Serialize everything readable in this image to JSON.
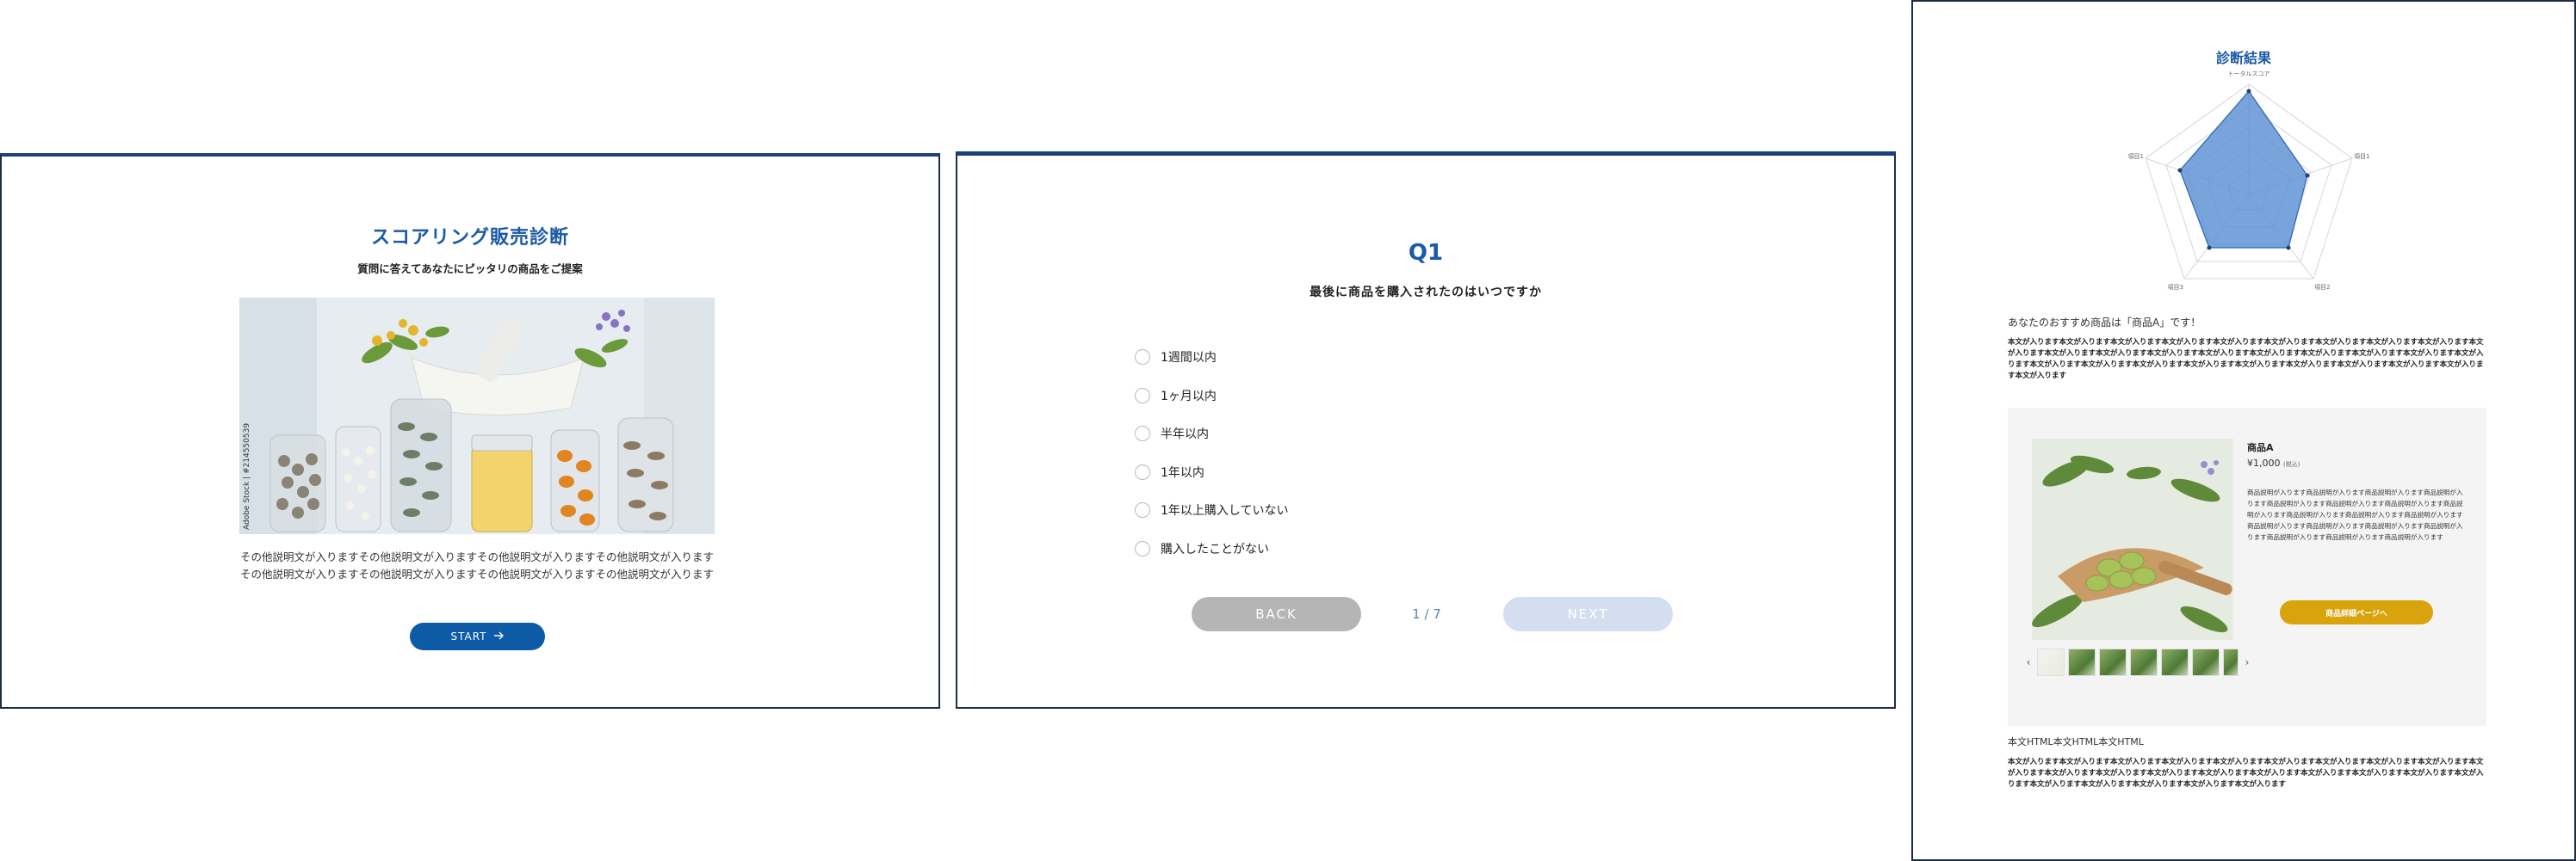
{
  "start": {
    "title": "スコアリング販売診断",
    "subtitle": "質問に答えてあなたにピッタリの商品をご提案",
    "image_credit": "Adobe Stock | #214550539",
    "description": "その他説明文が入りますその他説明文が入りますその他説明文が入りますその他説明文が入りますその他説明文が入りますその他説明文が入りますその他説明文が入りますその他説明文が入ります",
    "start_label": "START",
    "start_icon": "arrow-right-icon",
    "accent_color": "#1a5aa6",
    "button_color": "#0d5aa7"
  },
  "question": {
    "number": "Q1",
    "text": "最後に商品を購入されたのはいつですか",
    "options": [
      "1週間以内",
      "1ヶ月以内",
      "半年以内",
      "1年以内",
      "1年以上購入していない",
      "購入したことがない"
    ],
    "back_label": "BACK",
    "next_label": "NEXT",
    "progress": "1 / 7"
  },
  "result": {
    "title": "診断結果",
    "radar": {
      "axes": [
        "トータルスコア",
        "項目1",
        "項目2",
        "項目3",
        "項目1"
      ],
      "fill_color": "#5a8fd3"
    },
    "recommend_text": "あなたのおすすめ商品は「商品A」です！",
    "body_1": "本文が入ります本文が入ります本文が入ります本文が入ります本文が入ります本文が入ります本文が入ります本文が入ります本文が入ります本文が入ります本文が入ります本文が入ります本文が入ります本文が入ります本文が入ります本文が入ります本文が入ります本文が入ります本文が入ります本文が入ります本文が入ります本文が入ります本文が入ります本文が入ります本文が入ります本文が入ります本文が入ります本文が入ります本文が入ります",
    "product": {
      "name": "商品A",
      "price": "¥1,000",
      "tax": "(税込)",
      "description": "商品説明が入ります商品説明が入ります商品説明が入ります商品説明が入ります商品説明が入ります商品説明が入ります商品説明が入ります商品説明が入ります商品説明が入ります商品説明が入ります商品説明が入ります商品説明が入ります商品説明が入ります商品説明が入ります商品説明が入ります商品説明が入ります商品説明が入ります商品説明が入ります",
      "detail_label": "商品詳細ページへ",
      "detail_color": "#d9a30c",
      "prev_icon": "chevron-left-icon",
      "next_icon": "chevron-right-icon"
    },
    "body_html_label": "本文HTML本文HTML本文HTML",
    "body_2": "本文が入ります本文が入ります本文が入ります本文が入ります本文が入ります本文が入ります本文が入ります本文が入ります本文が入ります本文が入ります本文が入ります本文が入ります本文が入ります本文が入ります本文が入ります本文が入ります本文が入ります本文が入ります本文が入ります本文が入ります本文が入ります本文が入ります本文が入ります本文が入ります"
  }
}
